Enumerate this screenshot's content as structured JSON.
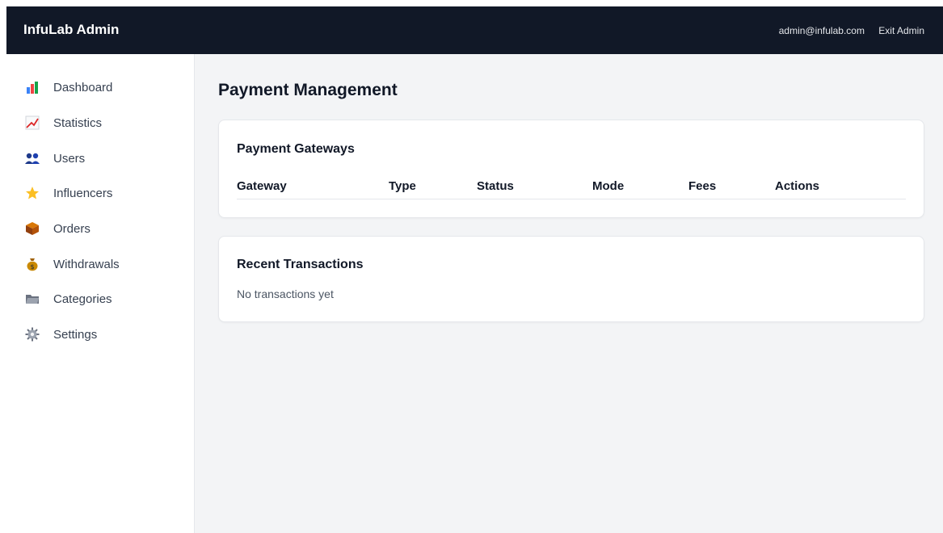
{
  "header": {
    "brand": "InfuLab Admin",
    "user_email": "admin@infulab.com",
    "exit_label": "Exit Admin"
  },
  "sidebar": {
    "items": [
      {
        "label": "Dashboard",
        "icon": "bar-chart-icon"
      },
      {
        "label": "Statistics",
        "icon": "line-chart-icon"
      },
      {
        "label": "Users",
        "icon": "users-icon"
      },
      {
        "label": "Influencers",
        "icon": "star-icon"
      },
      {
        "label": "Orders",
        "icon": "package-icon"
      },
      {
        "label": "Withdrawals",
        "icon": "money-bag-icon"
      },
      {
        "label": "Categories",
        "icon": "folder-icon"
      },
      {
        "label": "Settings",
        "icon": "gear-icon"
      }
    ]
  },
  "main": {
    "title": "Payment Management",
    "gateways": {
      "title": "Payment Gateways",
      "columns": [
        "Gateway",
        "Type",
        "Status",
        "Mode",
        "Fees",
        "Actions"
      ]
    },
    "transactions": {
      "title": "Recent Transactions",
      "empty_text": "No transactions yet"
    }
  },
  "colors": {
    "topbar": "#111827",
    "background": "#f3f4f6",
    "card": "#ffffff"
  }
}
